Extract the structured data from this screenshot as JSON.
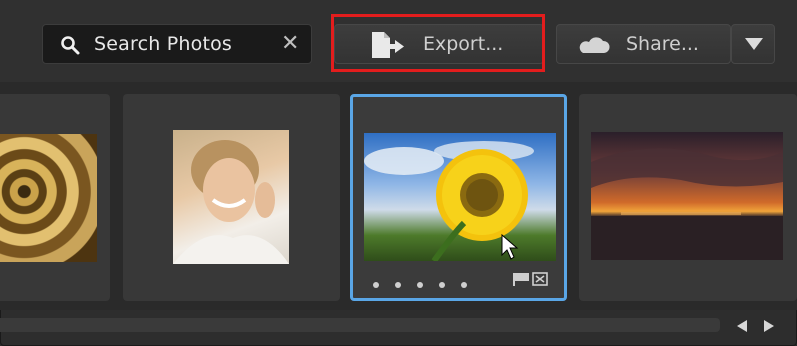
{
  "toolbar": {
    "search_placeholder": "Search Photos",
    "search_icon": "search-icon",
    "clear_icon": "close-icon",
    "export_label": "Export...",
    "export_icon": "export-icon",
    "share_label": "Share...",
    "share_icon": "cloud-icon",
    "menu_icon": "chevron-down-icon"
  },
  "highlight_color": "#e31d1d",
  "selection_color": "#5aa6e6",
  "filmstrip": {
    "photos": [
      {
        "name": "spiral-staircase"
      },
      {
        "name": "woman-portrait"
      },
      {
        "name": "sunflower",
        "selected": true,
        "rating_dots": 5
      },
      {
        "name": "sunset-sea"
      }
    ]
  }
}
